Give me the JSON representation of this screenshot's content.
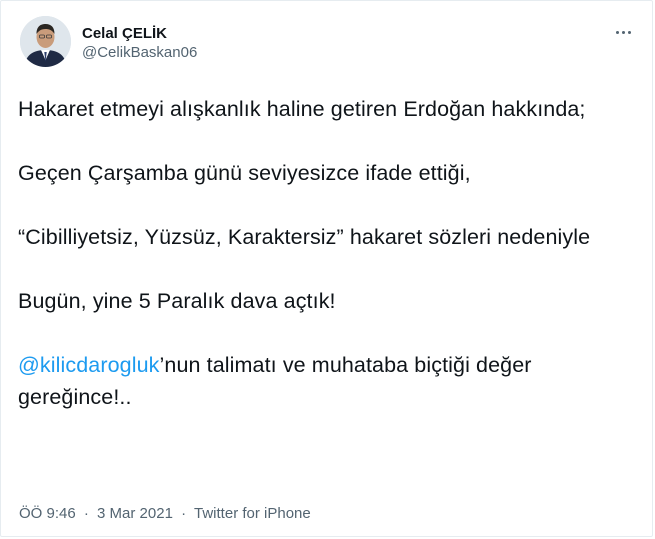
{
  "author": {
    "display_name": "Celal ÇELİK",
    "handle": "@CelikBaskan06"
  },
  "tweet": {
    "p1": "Hakaret etmeyi alışkanlık haline getiren Erdoğan hakkında;",
    "p2": "Geçen Çarşamba günü seviyesizce ifade ettiği,",
    "p3": "“Cibilliyetsiz, Yüzsüz, Karaktersiz” hakaret sözleri nedeniyle",
    "p4": "Bugün, yine 5 Paralık dava açtık!",
    "p5_mention": "@kilicdarogluk",
    "p5_rest": "’nun talimatı ve muhataba biçtiği değer gereğince!.."
  },
  "meta": {
    "time": "ÖÖ 9:46",
    "separator": "·",
    "date": "3 Mar 2021",
    "source": "Twitter for iPhone"
  },
  "colors": {
    "link": "#1d9bf0",
    "secondary_text": "#536471",
    "primary_text": "#0f1419"
  },
  "icons": {
    "more": "more-options-icon",
    "avatar": "profile-photo"
  }
}
